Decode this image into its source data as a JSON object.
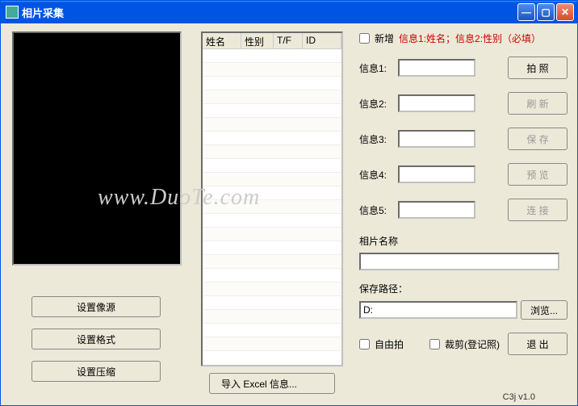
{
  "title": "相片采集",
  "listHeaders": {
    "c1": "姓名",
    "c2": "性别",
    "c3": "T/F",
    "c4": "ID"
  },
  "leftButtons": {
    "source": "设置像源",
    "format": "设置格式",
    "compress": "设置压缩"
  },
  "importBtn": "导入 Excel 信息...",
  "top": {
    "addNew": "新增",
    "hint": "信息1:姓名；信息2:性别（必填）"
  },
  "rows": {
    "r1": {
      "label": "信息1:",
      "btn": "拍 照"
    },
    "r2": {
      "label": "信息2:",
      "btn": "刷 新"
    },
    "r3": {
      "label": "信息3:",
      "btn": "保 存"
    },
    "r4": {
      "label": "信息4:",
      "btn": "预 览"
    },
    "r5": {
      "label": "信息5:",
      "btn": "连 接"
    }
  },
  "photoNameLabel": "相片名称",
  "savePathLabel": "保存路径：",
  "savePathValue": "D:",
  "browseBtn": "浏览...",
  "freeShoot": "自由拍",
  "crop": "裁剪(登记照)",
  "exitBtn": "退 出",
  "version": "C3j v1.0",
  "watermark": "www.DuoTe.com"
}
